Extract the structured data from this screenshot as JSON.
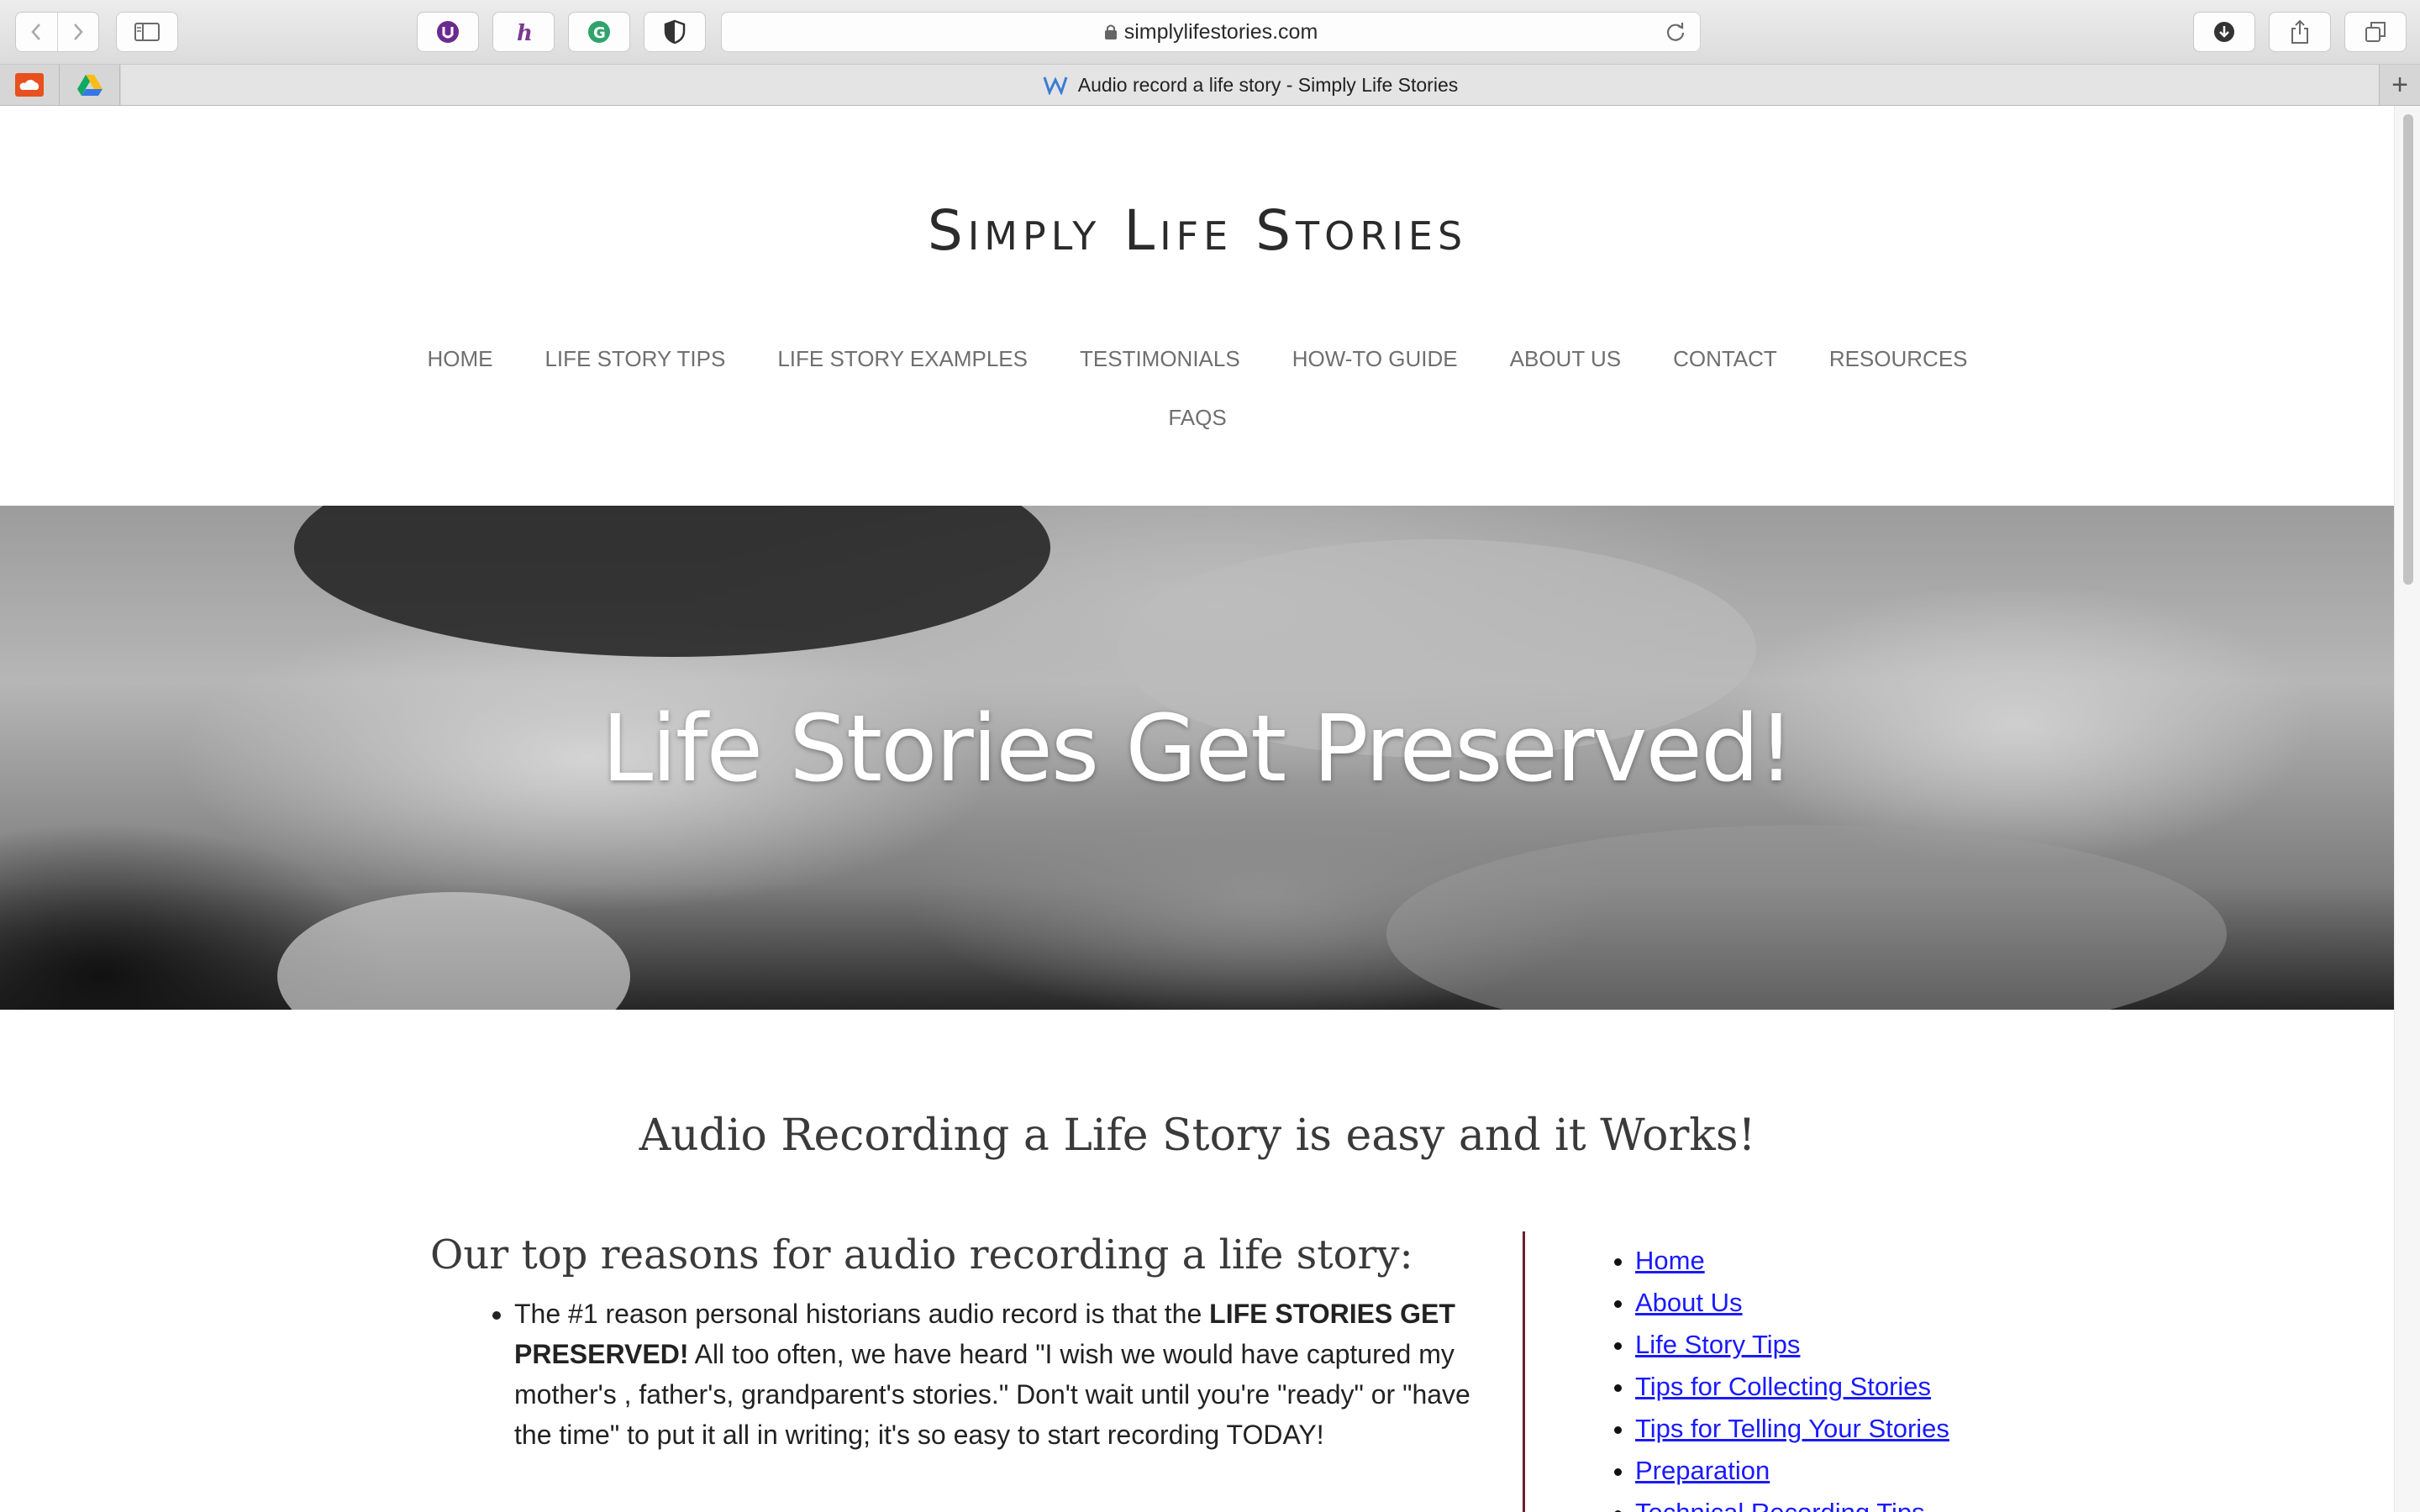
{
  "browser": {
    "url": "simplylifestories.com",
    "tab_title": "Audio record a life story - Simply Life Stories",
    "new_tab_symbol": "+",
    "extensions": [
      "extension-purple-icon",
      "honey-icon",
      "grammarly-icon",
      "privacy-shield-icon"
    ],
    "pinned_tabs": [
      "soundcloud-icon",
      "google-drive-icon"
    ]
  },
  "site": {
    "title": "Simply Life Stories",
    "nav": {
      "row1": [
        "HOME",
        "LIFE STORY TIPS",
        "LIFE STORY EXAMPLES",
        "TESTIMONIALS",
        "HOW-TO GUIDE",
        "ABOUT US",
        "CONTACT",
        "RESOURCES"
      ],
      "row2": [
        "FAQS"
      ]
    },
    "hero_title": "Life Stories Get Preserved!",
    "subheading": "Audio Recording a Life Story is easy and it Works!",
    "section_heading": "Our top reasons for audio recording a life story:",
    "reason1": {
      "before": "The #1 reason personal historians audio record is that the ",
      "bold": "LIFE STORIES GET PRESERVED!",
      "after": " All too often, we have heard \"I wish we would have captured my mother's , father's, grandparent's stories.\" Don't wait until you're \"ready\" or \"have the time\" to put it all in writing; it's so easy to start recording TODAY!"
    },
    "side_links": [
      "Home ",
      "About Us",
      "Life Story Tips",
      "Tips for Collecting Stories",
      "Tips for Telling Your Stories ",
      "Preparation",
      "Technical Recording Tips"
    ],
    "colors": {
      "divider": "#6b1f2a",
      "link": "#1a1aff",
      "nav_text": "#6f6f6f"
    }
  }
}
